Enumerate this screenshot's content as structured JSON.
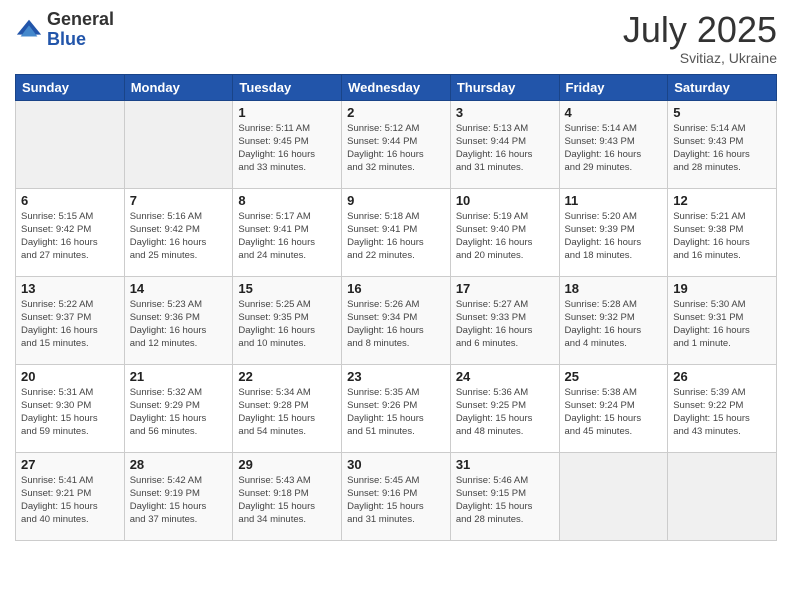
{
  "header": {
    "logo_general": "General",
    "logo_blue": "Blue",
    "title": "July 2025",
    "location": "Svitiaz, Ukraine"
  },
  "days_of_week": [
    "Sunday",
    "Monday",
    "Tuesday",
    "Wednesday",
    "Thursday",
    "Friday",
    "Saturday"
  ],
  "weeks": [
    [
      {
        "day": "",
        "info": ""
      },
      {
        "day": "",
        "info": ""
      },
      {
        "day": "1",
        "info": "Sunrise: 5:11 AM\nSunset: 9:45 PM\nDaylight: 16 hours\nand 33 minutes."
      },
      {
        "day": "2",
        "info": "Sunrise: 5:12 AM\nSunset: 9:44 PM\nDaylight: 16 hours\nand 32 minutes."
      },
      {
        "day": "3",
        "info": "Sunrise: 5:13 AM\nSunset: 9:44 PM\nDaylight: 16 hours\nand 31 minutes."
      },
      {
        "day": "4",
        "info": "Sunrise: 5:14 AM\nSunset: 9:43 PM\nDaylight: 16 hours\nand 29 minutes."
      },
      {
        "day": "5",
        "info": "Sunrise: 5:14 AM\nSunset: 9:43 PM\nDaylight: 16 hours\nand 28 minutes."
      }
    ],
    [
      {
        "day": "6",
        "info": "Sunrise: 5:15 AM\nSunset: 9:42 PM\nDaylight: 16 hours\nand 27 minutes."
      },
      {
        "day": "7",
        "info": "Sunrise: 5:16 AM\nSunset: 9:42 PM\nDaylight: 16 hours\nand 25 minutes."
      },
      {
        "day": "8",
        "info": "Sunrise: 5:17 AM\nSunset: 9:41 PM\nDaylight: 16 hours\nand 24 minutes."
      },
      {
        "day": "9",
        "info": "Sunrise: 5:18 AM\nSunset: 9:41 PM\nDaylight: 16 hours\nand 22 minutes."
      },
      {
        "day": "10",
        "info": "Sunrise: 5:19 AM\nSunset: 9:40 PM\nDaylight: 16 hours\nand 20 minutes."
      },
      {
        "day": "11",
        "info": "Sunrise: 5:20 AM\nSunset: 9:39 PM\nDaylight: 16 hours\nand 18 minutes."
      },
      {
        "day": "12",
        "info": "Sunrise: 5:21 AM\nSunset: 9:38 PM\nDaylight: 16 hours\nand 16 minutes."
      }
    ],
    [
      {
        "day": "13",
        "info": "Sunrise: 5:22 AM\nSunset: 9:37 PM\nDaylight: 16 hours\nand 15 minutes."
      },
      {
        "day": "14",
        "info": "Sunrise: 5:23 AM\nSunset: 9:36 PM\nDaylight: 16 hours\nand 12 minutes."
      },
      {
        "day": "15",
        "info": "Sunrise: 5:25 AM\nSunset: 9:35 PM\nDaylight: 16 hours\nand 10 minutes."
      },
      {
        "day": "16",
        "info": "Sunrise: 5:26 AM\nSunset: 9:34 PM\nDaylight: 16 hours\nand 8 minutes."
      },
      {
        "day": "17",
        "info": "Sunrise: 5:27 AM\nSunset: 9:33 PM\nDaylight: 16 hours\nand 6 minutes."
      },
      {
        "day": "18",
        "info": "Sunrise: 5:28 AM\nSunset: 9:32 PM\nDaylight: 16 hours\nand 4 minutes."
      },
      {
        "day": "19",
        "info": "Sunrise: 5:30 AM\nSunset: 9:31 PM\nDaylight: 16 hours\nand 1 minute."
      }
    ],
    [
      {
        "day": "20",
        "info": "Sunrise: 5:31 AM\nSunset: 9:30 PM\nDaylight: 15 hours\nand 59 minutes."
      },
      {
        "day": "21",
        "info": "Sunrise: 5:32 AM\nSunset: 9:29 PM\nDaylight: 15 hours\nand 56 minutes."
      },
      {
        "day": "22",
        "info": "Sunrise: 5:34 AM\nSunset: 9:28 PM\nDaylight: 15 hours\nand 54 minutes."
      },
      {
        "day": "23",
        "info": "Sunrise: 5:35 AM\nSunset: 9:26 PM\nDaylight: 15 hours\nand 51 minutes."
      },
      {
        "day": "24",
        "info": "Sunrise: 5:36 AM\nSunset: 9:25 PM\nDaylight: 15 hours\nand 48 minutes."
      },
      {
        "day": "25",
        "info": "Sunrise: 5:38 AM\nSunset: 9:24 PM\nDaylight: 15 hours\nand 45 minutes."
      },
      {
        "day": "26",
        "info": "Sunrise: 5:39 AM\nSunset: 9:22 PM\nDaylight: 15 hours\nand 43 minutes."
      }
    ],
    [
      {
        "day": "27",
        "info": "Sunrise: 5:41 AM\nSunset: 9:21 PM\nDaylight: 15 hours\nand 40 minutes."
      },
      {
        "day": "28",
        "info": "Sunrise: 5:42 AM\nSunset: 9:19 PM\nDaylight: 15 hours\nand 37 minutes."
      },
      {
        "day": "29",
        "info": "Sunrise: 5:43 AM\nSunset: 9:18 PM\nDaylight: 15 hours\nand 34 minutes."
      },
      {
        "day": "30",
        "info": "Sunrise: 5:45 AM\nSunset: 9:16 PM\nDaylight: 15 hours\nand 31 minutes."
      },
      {
        "day": "31",
        "info": "Sunrise: 5:46 AM\nSunset: 9:15 PM\nDaylight: 15 hours\nand 28 minutes."
      },
      {
        "day": "",
        "info": ""
      },
      {
        "day": "",
        "info": ""
      }
    ]
  ]
}
